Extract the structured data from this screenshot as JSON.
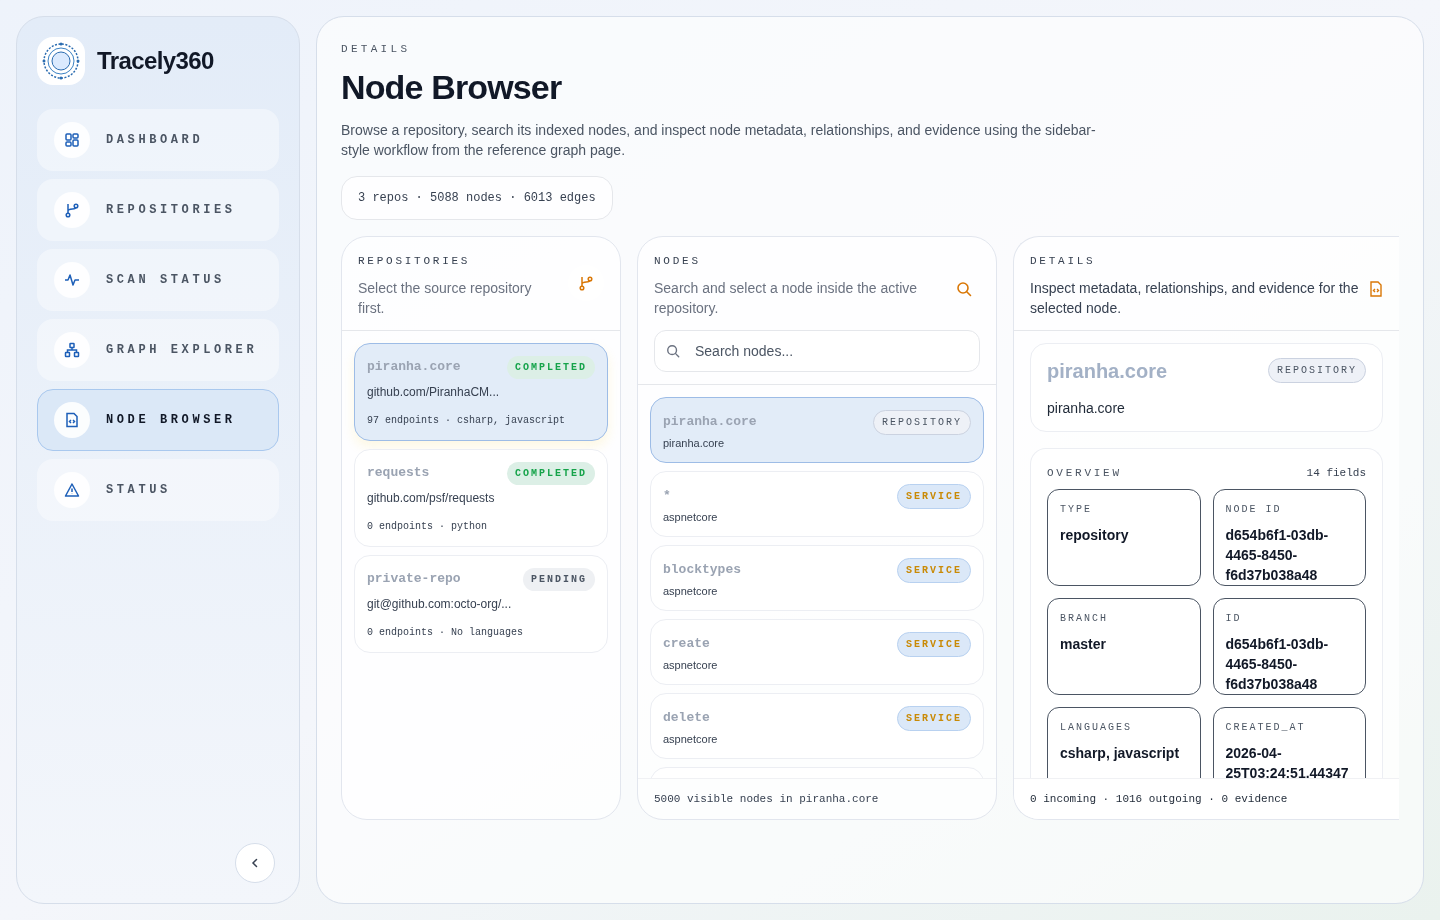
{
  "brand": {
    "name": "Tracely360"
  },
  "nav": [
    {
      "label": "DASHBOARD",
      "selected": false
    },
    {
      "label": "REPOSITORIES",
      "selected": false
    },
    {
      "label": "SCAN STATUS",
      "selected": false
    },
    {
      "label": "GRAPH EXPLORER",
      "selected": false
    },
    {
      "label": "NODE BROWSER",
      "selected": true
    },
    {
      "label": "STATUS",
      "selected": false
    }
  ],
  "header": {
    "eyebrow": "DETAILS",
    "title": "Node Browser",
    "description": "Browse a repository, search its indexed nodes, and inspect node metadata, relationships, and evidence using the sidebar-style workflow from the reference graph page.",
    "stats": "3 repos · 5088 nodes · 6013 edges"
  },
  "repositories": {
    "eyebrow": "REPOSITORIES",
    "subtitle": "Select the source repository first.",
    "items": [
      {
        "name": "piranha.core",
        "url": "github.com/PiranhaCM...",
        "meta": "97 endpoints · csharp, javascript",
        "status": "COMPLETED",
        "kind": "completed",
        "selected": true
      },
      {
        "name": "requests",
        "url": "github.com/psf/requests",
        "meta": "0 endpoints · python",
        "status": "COMPLETED",
        "kind": "completed",
        "selected": false
      },
      {
        "name": "private-repo",
        "url": "git@github.com:octo-org/...",
        "meta": "0 endpoints · No languages",
        "status": "PENDING",
        "kind": "pending",
        "selected": false
      }
    ]
  },
  "nodes": {
    "eyebrow": "NODES",
    "subtitle": "Search and select a node inside the active repository.",
    "search_placeholder": "Search nodes...",
    "items": [
      {
        "name": "piranha.core",
        "group": "piranha.core",
        "badge": "REPOSITORY",
        "kind": "repository",
        "selected": true
      },
      {
        "name": "*",
        "group": "aspnetcore",
        "badge": "SERVICE",
        "kind": "service",
        "selected": false
      },
      {
        "name": "blocktypes",
        "group": "aspnetcore",
        "badge": "SERVICE",
        "kind": "service",
        "selected": false
      },
      {
        "name": "create",
        "group": "aspnetcore",
        "badge": "SERVICE",
        "kind": "service",
        "selected": false
      },
      {
        "name": "delete",
        "group": "aspnetcore",
        "badge": "SERVICE",
        "kind": "service",
        "selected": false
      }
    ],
    "footer": "5000 visible nodes in piranha.core"
  },
  "details": {
    "eyebrow": "DETAILS",
    "subtitle": "Inspect metadata, relationships, and evidence for the selected node.",
    "node": {
      "name": "piranha.core",
      "subtitle": "piranha.core",
      "badge": "REPOSITORY"
    },
    "overview": {
      "title": "OVERVIEW",
      "count": "14 fields",
      "fields": [
        {
          "label": "TYPE",
          "value": "repository"
        },
        {
          "label": "NODE ID",
          "value": "d654b6f1-03db-4465-8450-f6d37b038a48"
        },
        {
          "label": "BRANCH",
          "value": "master"
        },
        {
          "label": "ID",
          "value": "d654b6f1-03db-4465-8450-f6d37b038a48"
        },
        {
          "label": "LANGUAGES",
          "value": "csharp, javascript"
        },
        {
          "label": "CREATED_AT",
          "value": "2026-04-25T03:24:51.44347"
        }
      ]
    },
    "footer": "0 incoming · 1016 outgoing · 0 evidence"
  }
}
